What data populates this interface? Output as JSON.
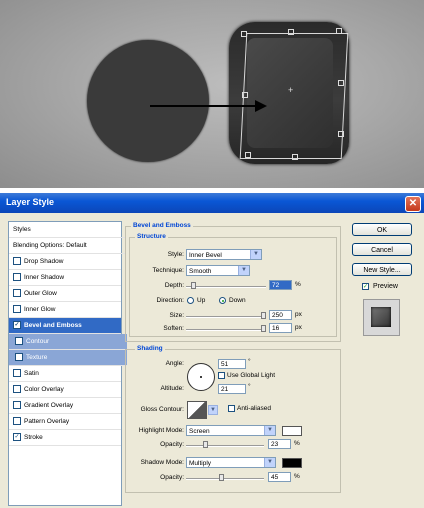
{
  "dialog": {
    "title": "Layer Style",
    "close_glyph": "✕"
  },
  "styles_list": [
    {
      "label": "Styles",
      "type": "header"
    },
    {
      "label": "Blending Options: Default",
      "type": "header"
    },
    {
      "label": "Drop Shadow",
      "checked": false
    },
    {
      "label": "Inner Shadow",
      "checked": false
    },
    {
      "label": "Outer Glow",
      "checked": false
    },
    {
      "label": "Inner Glow",
      "checked": false
    },
    {
      "label": "Bevel and Emboss",
      "checked": true,
      "selected": true
    },
    {
      "label": "Contour",
      "checked": false,
      "sub": true
    },
    {
      "label": "Texture",
      "checked": false,
      "sub": true
    },
    {
      "label": "Satin",
      "checked": false
    },
    {
      "label": "Color Overlay",
      "checked": false
    },
    {
      "label": "Gradient Overlay",
      "checked": false
    },
    {
      "label": "Pattern Overlay",
      "checked": false
    },
    {
      "label": "Stroke",
      "checked": true
    }
  ],
  "bevel": {
    "group_title": "Bevel and Emboss",
    "structure_title": "Structure",
    "style_label": "Style:",
    "style_value": "Inner Bevel",
    "technique_label": "Technique:",
    "technique_value": "Smooth",
    "depth_label": "Depth:",
    "depth_value": "72",
    "depth_unit": "%",
    "direction_label": "Direction:",
    "direction_up": "Up",
    "direction_down": "Down",
    "direction_selected": "Down",
    "size_label": "Size:",
    "size_value": "250",
    "size_unit": "px",
    "soften_label": "Soften:",
    "soften_value": "16",
    "soften_unit": "px"
  },
  "shading": {
    "title": "Shading",
    "angle_label": "Angle:",
    "angle_value": "51",
    "angle_unit": "°",
    "global_light_label": "Use Global Light",
    "global_light_checked": false,
    "altitude_label": "Altitude:",
    "altitude_value": "21",
    "altitude_unit": "°",
    "gloss_label": "Gloss Contour:",
    "antialiased_label": "Anti-aliased",
    "antialiased_checked": false,
    "highlight_mode_label": "Highlight Mode:",
    "highlight_mode_value": "Screen",
    "highlight_color": "#ffffff",
    "highlight_opacity_label": "Opacity:",
    "highlight_opacity_value": "23",
    "highlight_opacity_unit": "%",
    "shadow_mode_label": "Shadow Mode:",
    "shadow_mode_value": "Multiply",
    "shadow_color": "#000000",
    "shadow_opacity_label": "Opacity:",
    "shadow_opacity_value": "45",
    "shadow_opacity_unit": "%"
  },
  "buttons": {
    "ok": "OK",
    "cancel": "Cancel",
    "new_style": "New Style...",
    "preview_label": "Preview",
    "preview_checked": true
  },
  "sliders": {
    "depth": 0.07,
    "size": 1.0,
    "soften": 1.0,
    "highlight_opacity": 0.23,
    "shadow_opacity": 0.45
  },
  "colors": {
    "accent": "#316ac5",
    "title_bar": "#0a57d5",
    "section_title": "#0046d5"
  }
}
